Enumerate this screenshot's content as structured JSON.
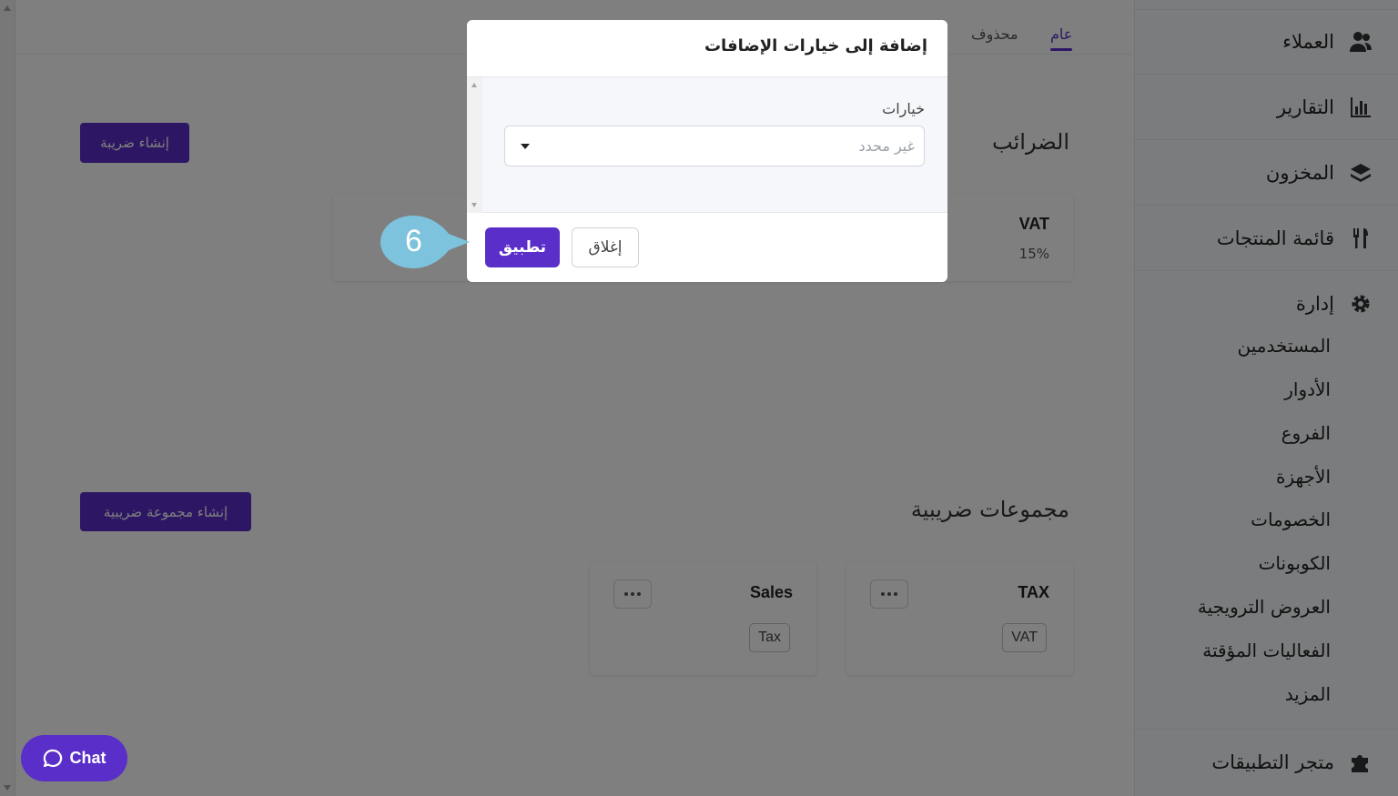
{
  "tabs": [
    {
      "label": "عام",
      "active": true
    },
    {
      "label": "محذوف",
      "active": false
    }
  ],
  "taxes": {
    "title": "الضرائب",
    "create_label": "إنشاء ضريبة",
    "cards": [
      {
        "name": "VAT",
        "rate": "15%"
      }
    ]
  },
  "tax_groups": {
    "title": "مجموعات ضريبية",
    "create_label": "إنشاء مجموعة ضريبية",
    "cards": [
      {
        "name": "TAX",
        "tag": "VAT"
      },
      {
        "name": "Sales",
        "tag": "Tax"
      }
    ]
  },
  "sidebar": {
    "items": [
      {
        "label": "العملاء",
        "icon": "customers-icon"
      },
      {
        "label": "التقارير",
        "icon": "reports-icon"
      },
      {
        "label": "المخزون",
        "icon": "inventory-icon"
      },
      {
        "label": "قائمة المنتجات",
        "icon": "menu-icon"
      },
      {
        "label": "إدارة",
        "icon": "gear-icon"
      }
    ],
    "manage_subitems": [
      "المستخدمين",
      "الأدوار",
      "الفروع",
      "الأجهزة",
      "الخصومات",
      "الكوبونات",
      "العروض الترويجية",
      "الفعاليات المؤقتة",
      "المزيد"
    ],
    "marketplace": {
      "label": "متجر التطبيقات",
      "icon": "puzzle-icon"
    }
  },
  "modal": {
    "title": "إضافة إلى خيارات الإضافات",
    "field_label": "خيارات",
    "select_placeholder": "غير محدد",
    "apply_label": "تطبيق",
    "close_label": "إغلاق"
  },
  "step_marker": {
    "number": "6",
    "color": "#7ec3dd"
  },
  "chat": {
    "label": "Chat"
  },
  "colors": {
    "accent": "#5a2ec8",
    "overlay": "rgba(0,0,0,0.5)"
  }
}
